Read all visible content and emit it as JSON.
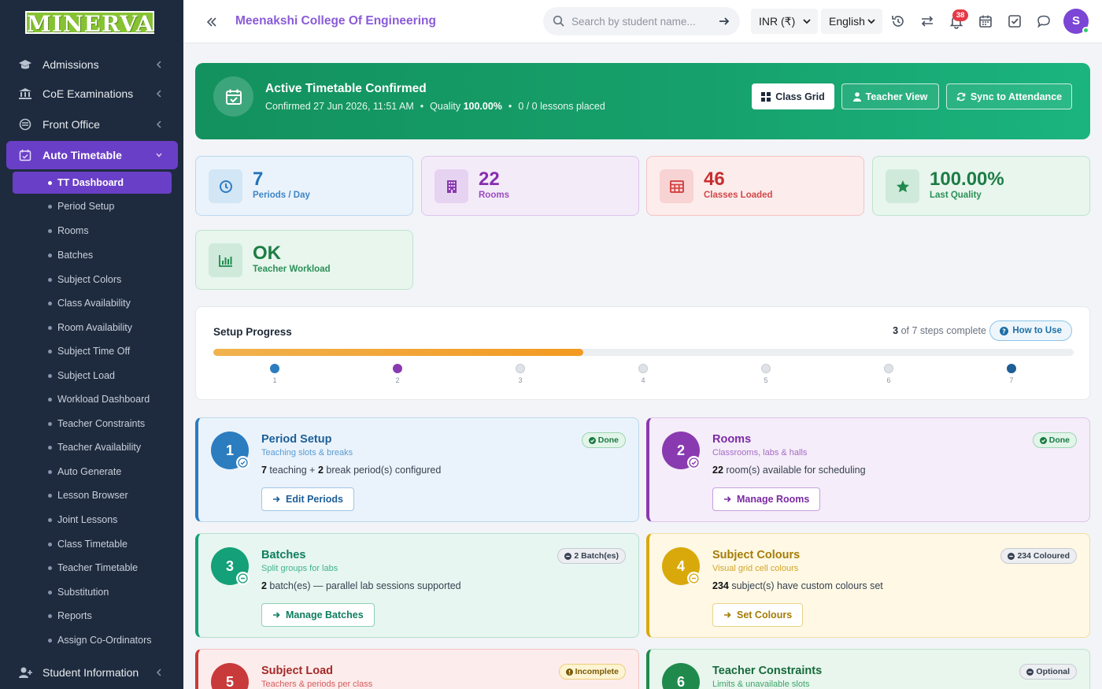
{
  "brand": {
    "logo_text": "MINERVA"
  },
  "sidebar": {
    "sections": [
      {
        "label": "Admissions",
        "icon": "graduation-cap-icon"
      },
      {
        "label": "CoE Examinations",
        "icon": "institution-icon"
      },
      {
        "label": "Front Office",
        "icon": "front-office-icon"
      },
      {
        "label": "Auto Timetable",
        "icon": "calendar-check-icon",
        "active": true
      },
      {
        "label": "Student Information",
        "icon": "user-plus-icon"
      }
    ],
    "sub_items": [
      {
        "label": "TT Dashboard",
        "active": true
      },
      {
        "label": "Period Setup"
      },
      {
        "label": "Rooms"
      },
      {
        "label": "Batches"
      },
      {
        "label": "Subject Colors"
      },
      {
        "label": "Class Availability"
      },
      {
        "label": "Room Availability"
      },
      {
        "label": "Subject Time Off"
      },
      {
        "label": "Subject Load"
      },
      {
        "label": "Workload Dashboard"
      },
      {
        "label": "Teacher Constraints"
      },
      {
        "label": "Teacher Availability"
      },
      {
        "label": "Auto Generate"
      },
      {
        "label": "Lesson Browser"
      },
      {
        "label": "Joint Lessons"
      },
      {
        "label": "Class Timetable"
      },
      {
        "label": "Teacher Timetable"
      },
      {
        "label": "Substitution"
      },
      {
        "label": "Reports"
      },
      {
        "label": "Assign Co-Ordinators"
      }
    ]
  },
  "header": {
    "college_name": "Meenakshi College Of Engineering",
    "search_placeholder": "Search by student name...",
    "currency": "INR (₹)",
    "language": "English",
    "notification_count": "38",
    "avatar_initial": "S"
  },
  "hero": {
    "title": "Active Timetable Confirmed",
    "confirmed": "Confirmed 27 Jun 2026, 11:51 AM",
    "quality_label": "Quality",
    "quality_value": "100.00%",
    "lessons": "0 / 0 lessons placed",
    "buttons": {
      "class_grid": "Class Grid",
      "teacher_view": "Teacher View",
      "sync": "Sync to Attendance"
    }
  },
  "stats": [
    {
      "value": "7",
      "label": "Periods / Day",
      "icon": "clock-icon"
    },
    {
      "value": "22",
      "label": "Rooms",
      "icon": "building-icon"
    },
    {
      "value": "46",
      "label": "Classes Loaded",
      "icon": "table-icon"
    },
    {
      "value": "100.00%",
      "label": "Last Quality",
      "icon": "star-icon"
    },
    {
      "value": "OK",
      "label": "Teacher Workload",
      "icon": "bar-chart-icon"
    }
  ],
  "progress": {
    "title": "Setup Progress",
    "complete_count": "3",
    "complete_text": "of 7 steps complete",
    "how_to_use": "How to Use",
    "fraction": 0.43,
    "steps": [
      "1",
      "2",
      "3",
      "4",
      "5",
      "6",
      "7"
    ]
  },
  "cards": [
    {
      "num": "1",
      "title": "Period Setup",
      "subtitle": "Teaching slots & breaks",
      "desc_pre": "",
      "desc_b1": "7",
      "desc_mid": " teaching + ",
      "desc_b2": "2",
      "desc_post": " break period(s) configured",
      "button": "Edit Periods",
      "badge": "Done"
    },
    {
      "num": "2",
      "title": "Rooms",
      "subtitle": "Classrooms, labs & halls",
      "desc_b1": "22",
      "desc_post": " room(s) available for scheduling",
      "button": "Manage Rooms",
      "badge": "Done"
    },
    {
      "num": "3",
      "title": "Batches",
      "subtitle": "Split groups for labs",
      "desc_b1": "2",
      "desc_post": " batch(es) — parallel lab sessions supported",
      "button": "Manage Batches",
      "badge": "2 Batch(es)"
    },
    {
      "num": "4",
      "title": "Subject Colours",
      "subtitle": "Visual grid cell colours",
      "desc_b1": "234",
      "desc_post": " subject(s) have custom colours set",
      "button": "Set Colours",
      "badge": "234 Coloured"
    },
    {
      "num": "5",
      "title": "Subject Load",
      "subtitle": "Teachers & periods per class",
      "badge": "Incomplete"
    },
    {
      "num": "6",
      "title": "Teacher Constraints",
      "subtitle": "Limits & unavailable slots",
      "badge": "Optional"
    }
  ],
  "colors": {
    "sidebar_bg": "#1e2b3e",
    "accent_purple": "#6a3fc7",
    "hero_green": "#16a06b",
    "progress_orange": "#f29a21"
  }
}
